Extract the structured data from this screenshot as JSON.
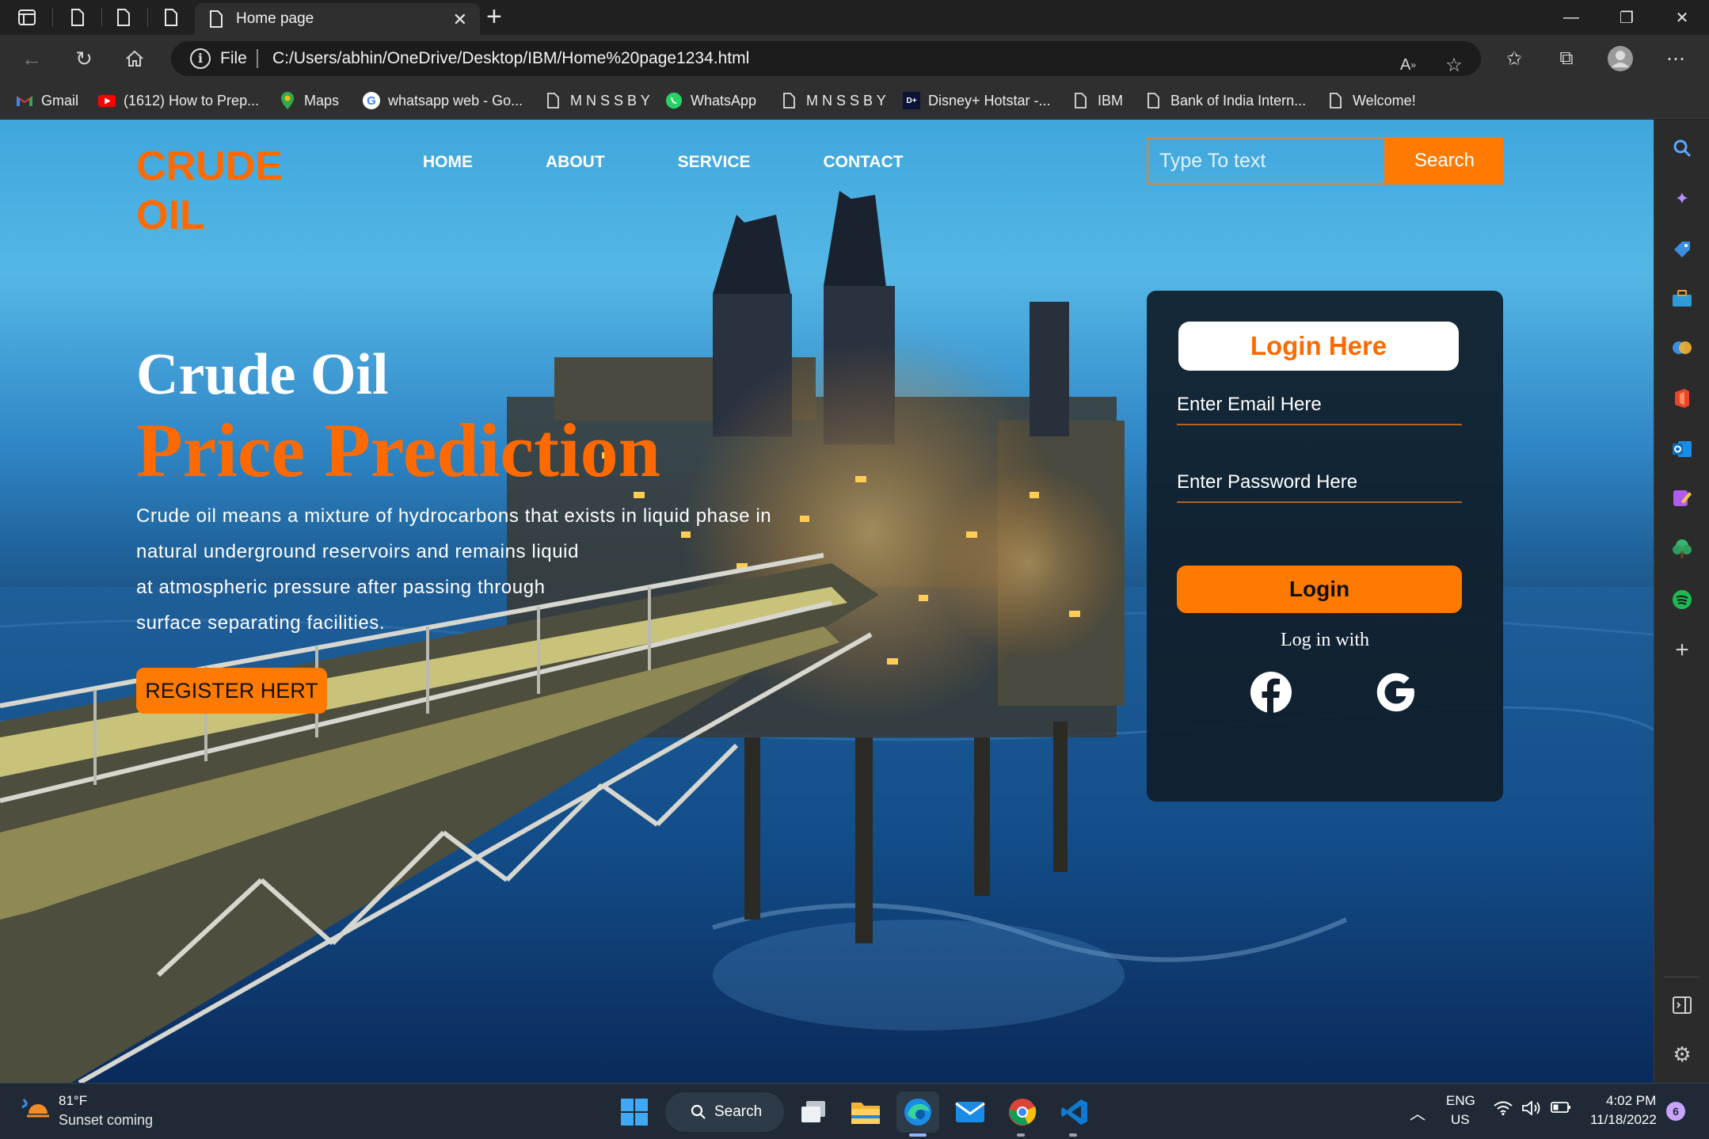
{
  "browser": {
    "active_tab_title": "Home page",
    "address_scheme": "File",
    "address_url": "C:/Users/abhin/OneDrive/Desktop/IBM/Home%20page1234.html",
    "bookmarks": [
      {
        "label": "Gmail",
        "icon": "gmail-icon"
      },
      {
        "label": "(1612) How to Prep...",
        "icon": "youtube-icon"
      },
      {
        "label": "Maps",
        "icon": "maps-icon"
      },
      {
        "label": "whatsapp web - Go...",
        "icon": "google-icon"
      },
      {
        "label": "M N S S B Y",
        "icon": "page-icon"
      },
      {
        "label": "WhatsApp",
        "icon": "whatsapp-icon"
      },
      {
        "label": "M N S S B Y",
        "icon": "page-icon"
      },
      {
        "label": "Disney+ Hotstar -...",
        "icon": "hotstar-icon"
      },
      {
        "label": "IBM",
        "icon": "page-icon"
      },
      {
        "label": "Bank of India Intern...",
        "icon": "page-icon"
      },
      {
        "label": "Welcome!",
        "icon": "page-icon"
      }
    ]
  },
  "page": {
    "logo": "CRUDE OIL",
    "nav": [
      "HOME",
      "ABOUT",
      "SERVICE",
      "CONTACT"
    ],
    "search_placeholder": "Type To text",
    "search_button": "Search",
    "hero_title_line1": "Crude Oil",
    "hero_title_line2": "Price Prediction",
    "hero_description": [
      "Crude oil means a mixture of hydrocarbons that exists in liquid phase in",
      "natural underground reservoirs and remains liquid",
      "at atmospheric pressure after passing through",
      "surface separating facilities."
    ],
    "register_button": "REGISTER HERT",
    "login": {
      "heading": "Login Here",
      "email_placeholder": "Enter Email Here",
      "password_placeholder": "Enter Password Here",
      "login_button": "Login",
      "login_with": "Log in with",
      "social_icons": [
        "facebook-icon",
        "google-icon"
      ]
    }
  },
  "taskbar": {
    "weather_temp": "81°F",
    "weather_desc": "Sunset coming",
    "search_label": "Search",
    "language_line1": "ENG",
    "language_line2": "US",
    "time": "4:02 PM",
    "date": "11/18/2022",
    "notification_count": "6"
  },
  "colors": {
    "accent_orange": "#ff7a00",
    "login_card": "#101e2a",
    "browser_chrome": "#202020"
  }
}
